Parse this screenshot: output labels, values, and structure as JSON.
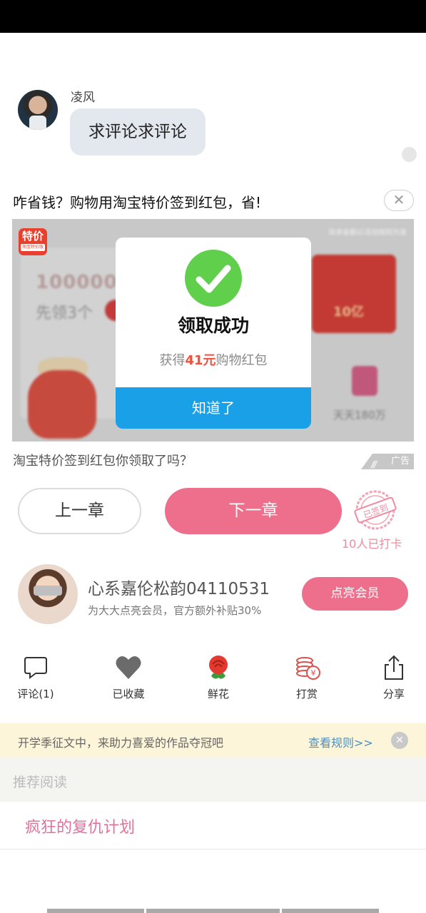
{
  "comment": {
    "author": "凌风",
    "text": "求评论求评论"
  },
  "ad": {
    "title": "咋省钱？购物用淘宝特价签到红包，省!",
    "close_label": "✕",
    "image": {
      "logo_text": "特价",
      "logo_sub": "淘宝特价版",
      "top_note": "具体金额以活动规则为准",
      "big_number": "1000000",
      "sub_text": "先领3个",
      "envelope_text": "10亿",
      "daily_text": "天天180万"
    },
    "popup": {
      "title": "领取成功",
      "desc_prefix": "获得",
      "desc_amount": "41元",
      "desc_suffix": "购物红包",
      "button": "知道了"
    },
    "caption": "淘宝特价签到红包你领取了吗？",
    "tag": "广告"
  },
  "chapter_nav": {
    "prev": "上一章",
    "next": "下一章",
    "stamp_text": "已签到",
    "checkin_count": "10人已打卡"
  },
  "member": {
    "name": "心系嘉伦松韵04110531",
    "subtitle": "为大大点亮会员，官方额外补贴30%",
    "button": "点亮会员"
  },
  "actions": [
    {
      "label": "评论(1)",
      "icon": "comment-icon"
    },
    {
      "label": "已收藏",
      "icon": "heart-icon"
    },
    {
      "label": "鲜花",
      "icon": "rose-icon"
    },
    {
      "label": "打赏",
      "icon": "coins-icon"
    },
    {
      "label": "分享",
      "icon": "share-icon"
    }
  ],
  "banner": {
    "text": "开学季征文中，来助力喜爱的作品夺冠吧",
    "link": "查看规则>>",
    "close": "✕"
  },
  "recommend": {
    "heading": "推荐阅读",
    "items": [
      "疯狂的复仇计划"
    ]
  },
  "colors": {
    "accent_pink": "#ee6f8b",
    "popup_button_blue": "#1aa0e7",
    "success_green": "#5fcf4c",
    "amount_red": "#f0513e"
  }
}
